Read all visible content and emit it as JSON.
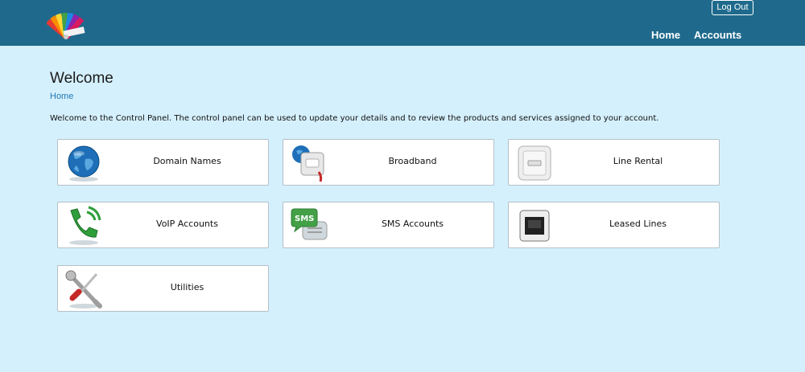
{
  "header": {
    "logout_label": "Log Out",
    "nav": [
      {
        "label": "Home"
      },
      {
        "label": "Accounts"
      }
    ],
    "bar_color": "#1f6a8c"
  },
  "page": {
    "title": "Welcome",
    "breadcrumb": "Home",
    "intro": "Welcome to the Control Panel. The control panel can be used to update your details and to review the products and services assigned to your account.",
    "background": "#d5f0fd"
  },
  "tiles": [
    {
      "label": "Domain Names",
      "icon": "globe-icon"
    },
    {
      "label": "Broadband",
      "icon": "broadband-router-icon"
    },
    {
      "label": "Line Rental",
      "icon": "phone-socket-icon"
    },
    {
      "label": "VoIP Accounts",
      "icon": "voip-phone-icon"
    },
    {
      "label": "SMS Accounts",
      "icon": "sms-bubble-icon"
    },
    {
      "label": "Leased Lines",
      "icon": "ethernet-port-icon"
    },
    {
      "label": "Utilities",
      "icon": "tools-icon"
    }
  ]
}
